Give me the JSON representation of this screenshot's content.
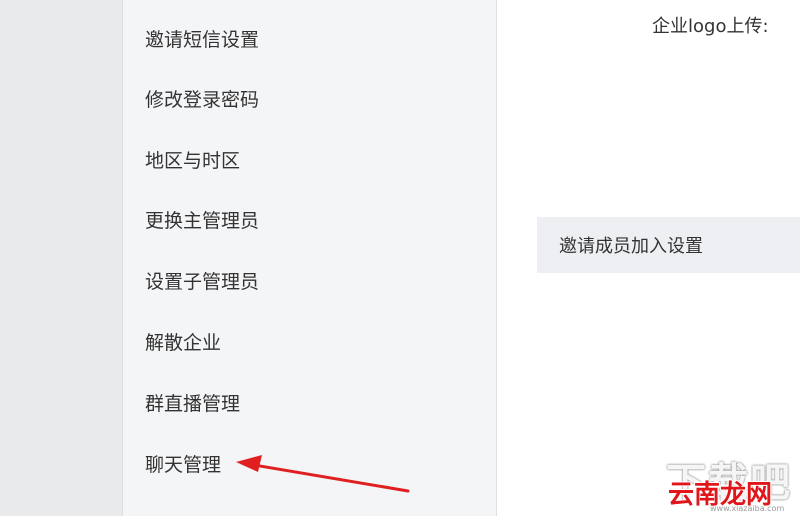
{
  "sidebar": {
    "items": [
      {
        "label": "邀请短信设置"
      },
      {
        "label": "修改登录密码"
      },
      {
        "label": "地区与时区"
      },
      {
        "label": "更换主管理员"
      },
      {
        "label": "设置子管理员"
      },
      {
        "label": "解散企业"
      },
      {
        "label": "群直播管理"
      },
      {
        "label": "聊天管理"
      }
    ]
  },
  "content": {
    "logo_upload_label": "企业logo上传:",
    "invite_section_title": "邀请成员加入设置"
  },
  "annotation": {
    "arrow_color": "#e02020",
    "points_to": "聊天管理"
  },
  "watermark": {
    "main": "云南龙网",
    "overlay": "下载吧",
    "url": "www.xiazaiba.com",
    "main_color": "#e0161b"
  }
}
